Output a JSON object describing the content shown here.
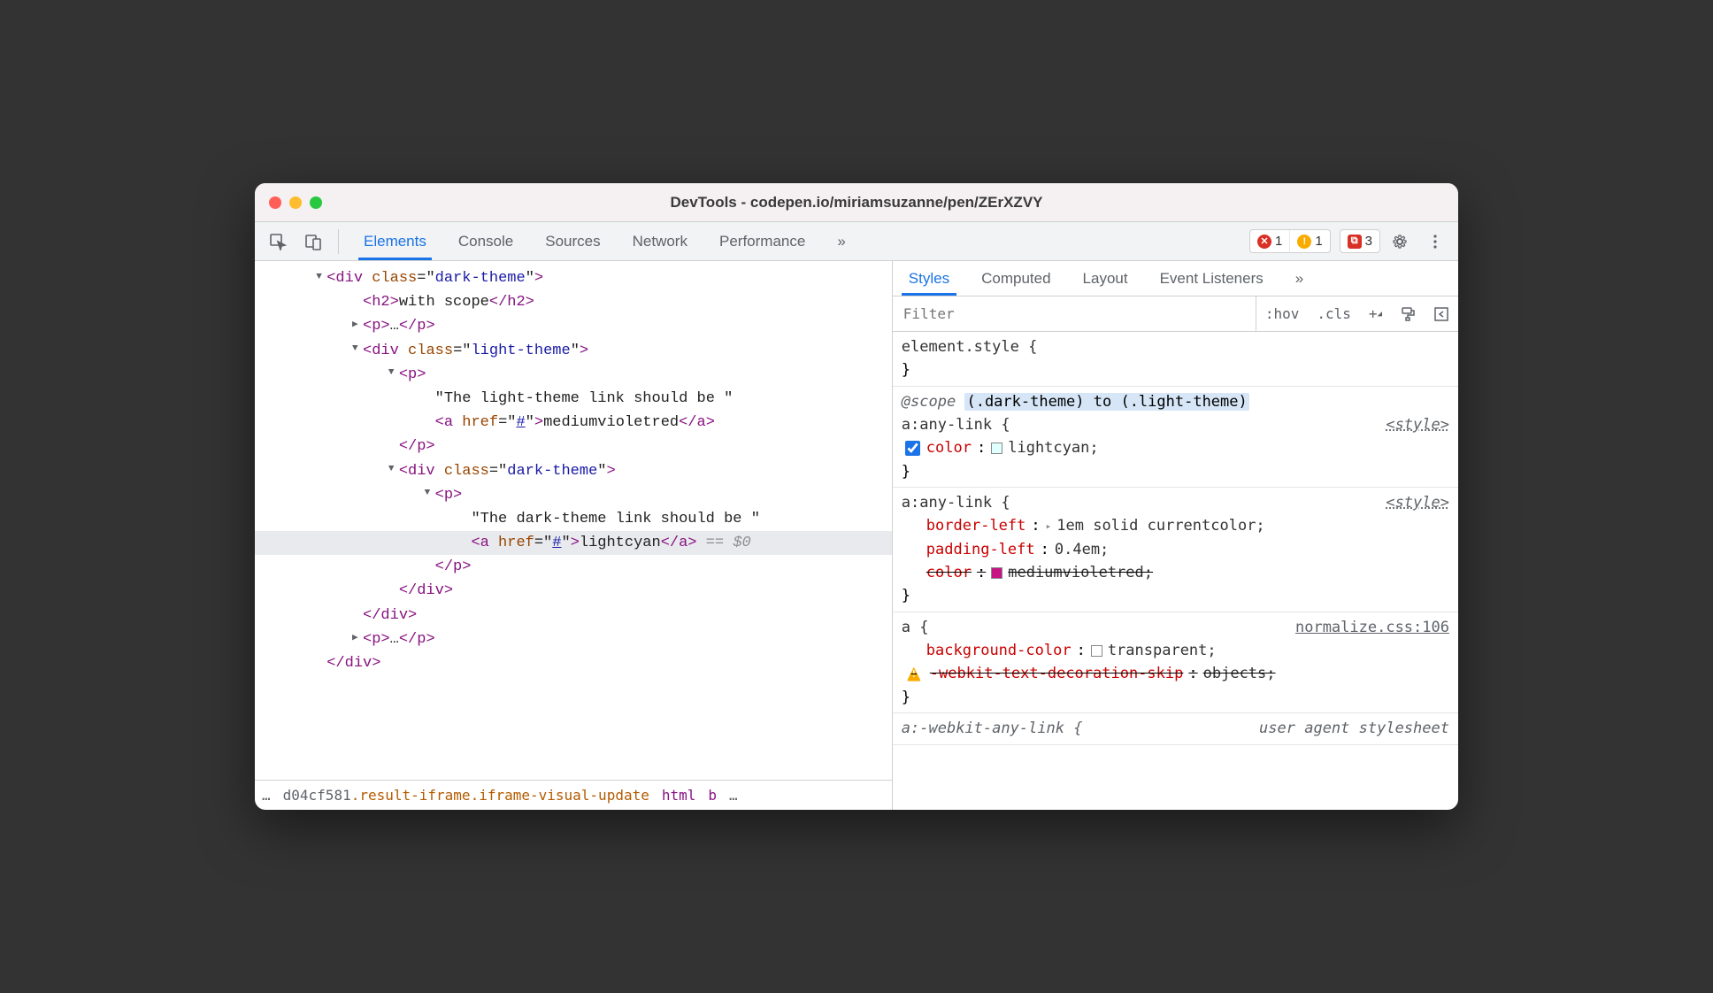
{
  "window": {
    "title": "DevTools - codepen.io/miriamsuzanne/pen/ZErXZVY"
  },
  "toolbar": {
    "tabs": [
      "Elements",
      "Console",
      "Sources",
      "Network",
      "Performance"
    ],
    "more": "»",
    "badges": {
      "errors": "1",
      "warnings": "1",
      "messages": "3"
    }
  },
  "dom": {
    "lines": [
      {
        "indent": 3,
        "tri": "▼",
        "html": "<span class='tag'>&lt;div</span> <span class='attr-name'>class</span>=\"<span class='attr-val'>dark-theme</span>\"<span class='tag'>&gt;</span>"
      },
      {
        "indent": 5,
        "tri": "",
        "html": "<span class='tag'>&lt;h2&gt;</span><span class='text-node'>with scope</span><span class='tag'>&lt;/h2&gt;</span>"
      },
      {
        "indent": 5,
        "tri": "▶",
        "html": "<span class='tag'>&lt;p&gt;</span><span class='ellipsis'>…</span><span class='tag'>&lt;/p&gt;</span>"
      },
      {
        "indent": 5,
        "tri": "▼",
        "html": "<span class='tag'>&lt;div</span> <span class='attr-name'>class</span>=\"<span class='attr-val'>light-theme</span>\"<span class='tag'>&gt;</span>"
      },
      {
        "indent": 7,
        "tri": "▼",
        "html": "<span class='tag'>&lt;p&gt;</span>"
      },
      {
        "indent": 9,
        "tri": "",
        "html": "<span class='text-node'>\"The light-theme link should be \"</span>"
      },
      {
        "indent": 9,
        "tri": "",
        "html": "<span class='tag'>&lt;a</span> <span class='attr-name'>href</span>=\"<span class='attr-val linked'>#</span>\"<span class='tag'>&gt;</span><span class='text-node'>mediumvioletred</span><span class='tag'>&lt;/a&gt;</span>"
      },
      {
        "indent": 7,
        "tri": "",
        "html": "<span class='tag'>&lt;/p&gt;</span>"
      },
      {
        "indent": 7,
        "tri": "▼",
        "html": "<span class='tag'>&lt;div</span> <span class='attr-name'>class</span>=\"<span class='attr-val'>dark-theme</span>\"<span class='tag'>&gt;</span>"
      },
      {
        "indent": 9,
        "tri": "▼",
        "html": "<span class='tag'>&lt;p&gt;</span>"
      },
      {
        "indent": 11,
        "tri": "",
        "html": "<span class='text-node'>\"The dark-theme link should be \"</span>"
      },
      {
        "indent": 11,
        "tri": "",
        "selected": true,
        "html": "<span class='tag'>&lt;a</span> <span class='attr-name'>href</span>=\"<span class='attr-val linked'>#</span>\"<span class='tag'>&gt;</span><span class='text-node'>lightcyan</span><span class='tag'>&lt;/a&gt;</span> <span class='selected-marker'>== $0</span>"
      },
      {
        "indent": 9,
        "tri": "",
        "html": "<span class='tag'>&lt;/p&gt;</span>"
      },
      {
        "indent": 7,
        "tri": "",
        "html": "<span class='tag'>&lt;/div&gt;</span>"
      },
      {
        "indent": 5,
        "tri": "",
        "html": "<span class='tag'>&lt;/div&gt;</span>"
      },
      {
        "indent": 5,
        "tri": "▶",
        "html": "<span class='tag'>&lt;p&gt;</span><span class='ellipsis'>…</span><span class='tag'>&lt;/p&gt;</span>"
      },
      {
        "indent": 3,
        "tri": "",
        "html": "<span class='tag'>&lt;/div&gt;</span>"
      }
    ]
  },
  "breadcrumb": {
    "prefix": "…",
    "part1": "d04cf581",
    "part2": ".result-iframe.iframe-visual-update",
    "part3": "html",
    "part4": "b",
    "suffix": "…"
  },
  "subtabs": {
    "items": [
      "Styles",
      "Computed",
      "Layout",
      "Event Listeners"
    ],
    "more": "»"
  },
  "filter": {
    "placeholder": "Filter",
    "hov": ":hov",
    "cls": ".cls",
    "plus": "+"
  },
  "styles": {
    "element_style": "element.style {",
    "brace_close": "}",
    "rule1": {
      "scope_prefix": "@scope",
      "scope_hl": "(.dark-theme) to (.light-theme)",
      "selector": "a:any-link {",
      "origin": "<style>",
      "prop_name": "color",
      "prop_val": "lightcyan;",
      "swatch": "#e0ffff"
    },
    "rule2": {
      "selector": "a:any-link {",
      "origin": "<style>",
      "p1_name": "border-left",
      "p1_val": "1em solid currentcolor;",
      "p2_name": "padding-left",
      "p2_val": "0.4em;",
      "p3_name": "color",
      "p3_val": "mediumvioletred;",
      "p3_swatch": "#c71585"
    },
    "rule3": {
      "selector": "a {",
      "origin": "normalize.css:106",
      "p1_name": "background-color",
      "p1_val": "transparent;",
      "p2_name": "-webkit-text-decoration-skip",
      "p2_val": "objects;"
    },
    "rule4": {
      "selector": "a:-webkit-any-link {",
      "origin": "user agent stylesheet"
    }
  }
}
